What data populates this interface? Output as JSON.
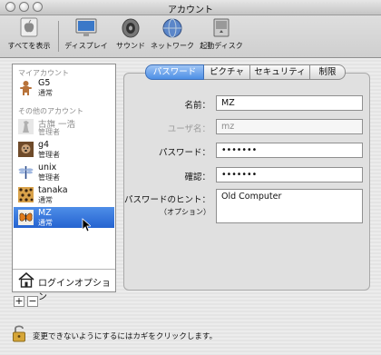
{
  "window": {
    "title": "アカウント"
  },
  "toolbar": {
    "items": [
      {
        "label": "すべてを表示",
        "icon": "apple-show-all-icon"
      },
      {
        "label": "ディスプレイ",
        "icon": "display-icon"
      },
      {
        "label": "サウンド",
        "icon": "speaker-icon"
      },
      {
        "label": "ネットワーク",
        "icon": "network-globe-icon"
      },
      {
        "label": "起動ディスク",
        "icon": "startup-disk-icon"
      }
    ]
  },
  "sidebar": {
    "my_account_header": "マイアカウント",
    "other_accounts_header": "その他のアカウント",
    "my_account": {
      "name": "G5",
      "role": "通常"
    },
    "accounts": [
      {
        "name": "古旗 一浩",
        "role": "管理者"
      },
      {
        "name": "g4",
        "role": "管理者"
      },
      {
        "name": "unix",
        "role": "管理者"
      },
      {
        "name": "tanaka",
        "role": "通常"
      },
      {
        "name": "MZ",
        "role": "通常"
      }
    ],
    "login_options": "ログインオプション",
    "add_button": "+",
    "remove_button": "−"
  },
  "tabs": [
    "パスワード",
    "ピクチャ",
    "セキュリティ",
    "制限"
  ],
  "form": {
    "name_label": "名前：",
    "name_value": "MZ",
    "short_name_label": "ユーザ名：",
    "short_name_value": "mz",
    "password_label": "パスワード：",
    "password_value": "•••••••",
    "verify_label": "確認：",
    "verify_value": "•••••••",
    "hint_label": "パスワードのヒント：",
    "hint_optional": "（オプション）",
    "hint_value": "Old Computer"
  },
  "footer": {
    "lock_text": "変更できないようにするにはカギをクリックします。"
  },
  "colors": {
    "selection": "#2f6fd6",
    "tab_active": "#5b9aeb"
  }
}
